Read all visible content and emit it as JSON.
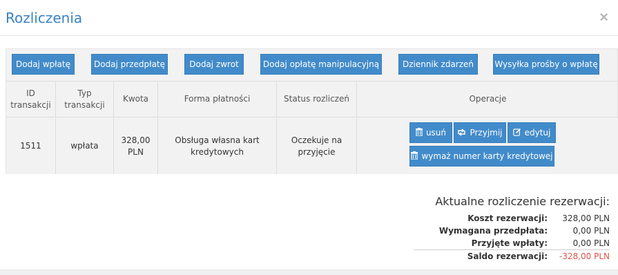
{
  "modal": {
    "title": "Rozliczenia",
    "close_label": "×"
  },
  "toolbar": {
    "buttons": [
      {
        "label": "Dodaj wpłatę"
      },
      {
        "label": "Dodaj przedpłatę"
      },
      {
        "label": "Dodaj zwrot"
      },
      {
        "label": "Dodaj opłatę manipulacyjną"
      },
      {
        "label": "Dziennik zdarzeń"
      },
      {
        "label": "Wysyłka prośby o wpłatę"
      }
    ]
  },
  "table": {
    "headers": [
      "ID transakcji",
      "Typ transakcji",
      "Kwota",
      "Forma płatności",
      "Status rozliczeń",
      "Operacje"
    ],
    "rows": [
      {
        "id": "1511",
        "type": "wpłata",
        "amount": "328,00 PLN",
        "payment_form": "Obsługa własna kart kredytowych",
        "status": "Oczekuje na przyjęcie",
        "operations": {
          "delete_label": "usuń",
          "accept_label": "Przyjmij",
          "edit_label": "edytuj",
          "wipe_card_label": "wymaż numer karty kredytowej"
        }
      }
    ]
  },
  "icons": {
    "delete": "trash-icon",
    "accept": "retweet-icon",
    "edit": "edit-icon",
    "wipe": "trash-icon"
  },
  "summary": {
    "title": "Aktualne rozliczenie rezerwacji:",
    "rows": [
      {
        "label": "Koszt rezerwacji:",
        "value": "328,00 PLN"
      },
      {
        "label": "Wymagana przedpłata:",
        "value": "0,00 PLN"
      },
      {
        "label": "Przyjęte wpłaty:",
        "value": "0,00 PLN"
      },
      {
        "label": "Saldo rezerwacji:",
        "value": "-328,00 PLN"
      }
    ]
  },
  "colors": {
    "accent": "#428bca",
    "title": "#3a82c4",
    "negative": "#d9534f"
  }
}
